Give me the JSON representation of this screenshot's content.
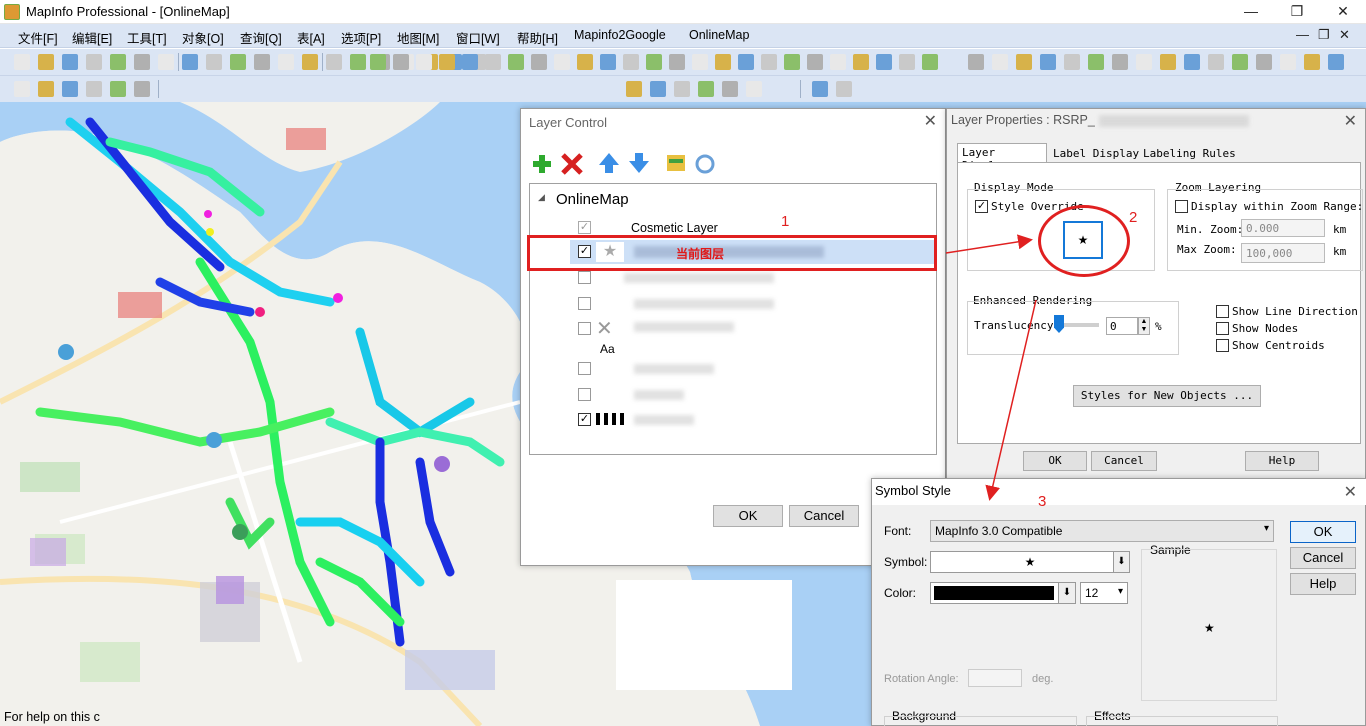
{
  "window": {
    "title": "MapInfo Professional - [OnlineMap]",
    "minimize": "—",
    "restore": "❐",
    "close": "✕"
  },
  "menu": {
    "items": [
      "文件[F]",
      "编辑[E]",
      "工具[T]",
      "对象[O]",
      "查询[Q]",
      "表[A]",
      "选项[P]",
      "地图[M]",
      "窗口[W]",
      "帮助[H]",
      "Mapinfo2Google",
      "OnlineMap"
    ],
    "mdi_min": "—",
    "mdi_restore": "❐",
    "mdi_close": "✕"
  },
  "status": {
    "text": "For help on this c"
  },
  "layer_control": {
    "title": "Layer Control",
    "root": "OnlineMap",
    "cosmetic": "Cosmetic Layer",
    "current_label": "当前图层",
    "aa_label": "Aa",
    "ok": "OK",
    "cancel": "Cancel",
    "annotation": "1"
  },
  "layer_properties": {
    "title": "Layer Properties : RSRP_",
    "tabs": [
      "Layer Display",
      "Label Display",
      "Labeling Rules"
    ],
    "display_mode_label": "Display Mode",
    "style_override": "Style Override",
    "zoom_label": "Zoom Layering",
    "display_within": "Display within Zoom Range:",
    "min_zoom_label": "Min. Zoom:",
    "min_zoom_value": "0.000",
    "max_zoom_label": "Max Zoom:",
    "max_zoom_value": "100,000",
    "unit": "km",
    "enhanced_label": "Enhanced Rendering",
    "translucency_label": "Translucency",
    "translucency_value": "0",
    "percent": "%",
    "show_line_direction": "Show Line Direction",
    "show_nodes": "Show Nodes",
    "show_centroids": "Show Centroids",
    "styles_button": "Styles for New Objects ...",
    "ok": "OK",
    "cancel": "Cancel",
    "help": "Help",
    "annotation": "2",
    "symbol_glyph": "★"
  },
  "symbol_style": {
    "title": "Symbol Style",
    "font_label": "Font:",
    "font_value": "MapInfo 3.0 Compatible",
    "symbol_label": "Symbol:",
    "symbol_value": "★",
    "color_label": "Color:",
    "size_value": "12",
    "sample_label": "Sample",
    "sample_glyph": "★",
    "rotation_label": "Rotation Angle:",
    "deg": "deg.",
    "background_label": "Background",
    "effects_label": "Effects",
    "ok": "OK",
    "cancel": "Cancel",
    "help": "Help",
    "annotation": "3",
    "color_value": "#000000"
  },
  "colors": {
    "annotation": "#e02020",
    "accent": "#0a64c8"
  }
}
